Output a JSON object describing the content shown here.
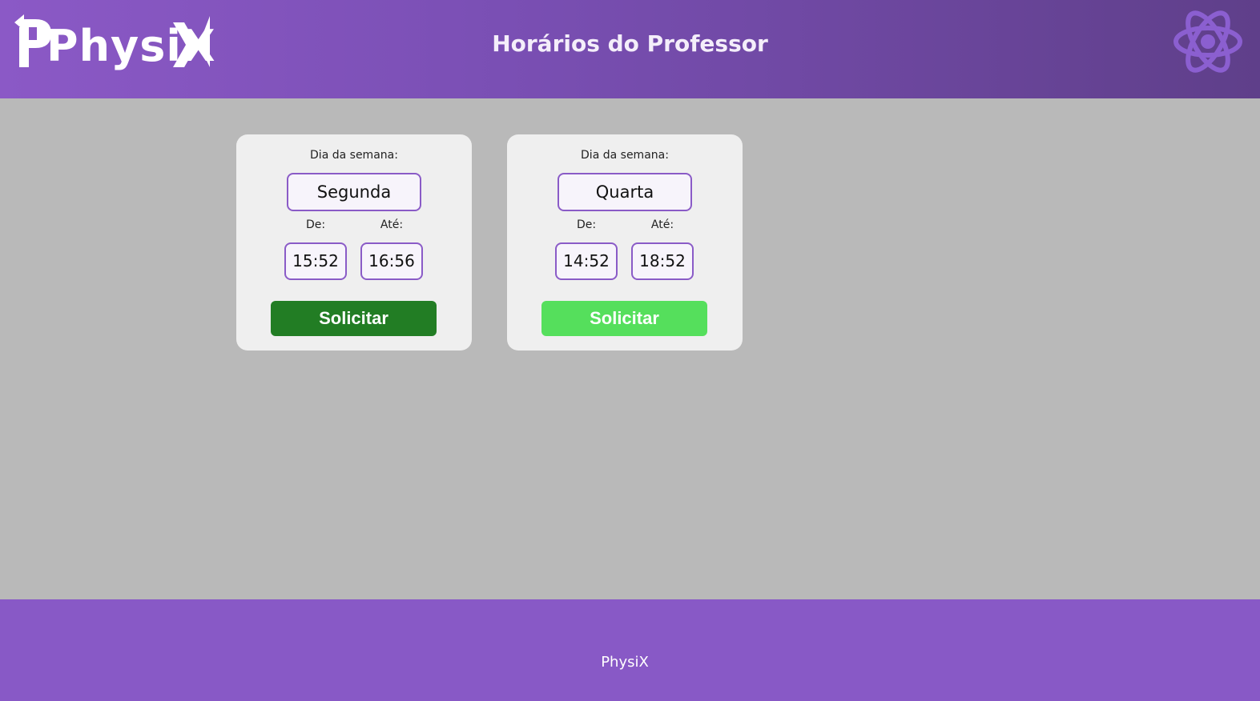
{
  "header": {
    "logo_text": "PhysiX",
    "title": "Horários do Professor",
    "background_colors": [
      "#8b59c6",
      "#5f3f8a"
    ],
    "icon": "atom-icon"
  },
  "schedules": [
    {
      "day_label": "Dia da semana:",
      "day": "Segunda",
      "from_label": "De:",
      "from": "15:52",
      "to_label": "Até:",
      "to": "16:56",
      "button_label": "Solicitar",
      "button_color": "#227d24"
    },
    {
      "day_label": "Dia da semana:",
      "day": "Quarta",
      "from_label": "De:",
      "from": "14:52",
      "to_label": "Até:",
      "to": "18:52",
      "button_label": "Solicitar",
      "button_color": "#55df5c"
    }
  ],
  "footer": {
    "text": "PhysiX",
    "background_color": "#8859c6"
  }
}
